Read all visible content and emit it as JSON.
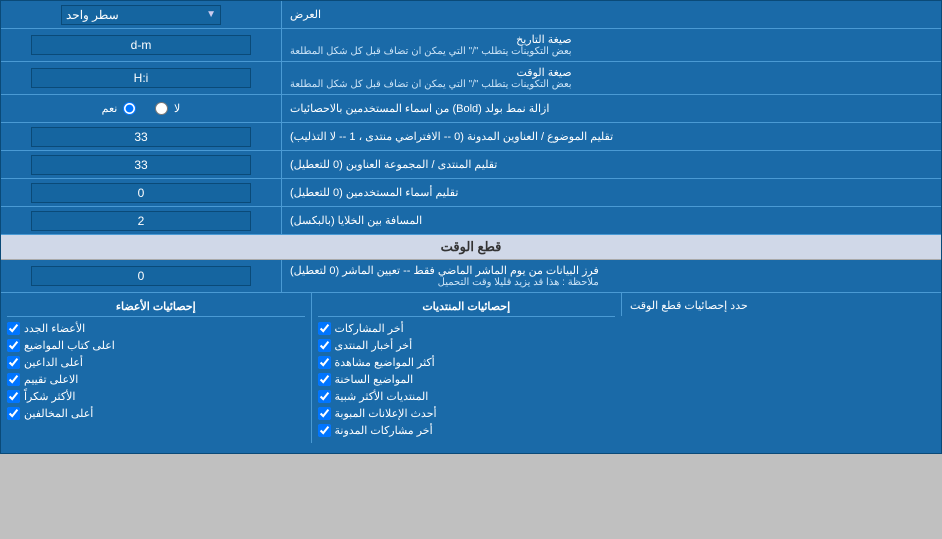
{
  "title": "العرض",
  "rows": [
    {
      "id": "row-display",
      "label": "العرض",
      "input_type": "dropdown",
      "input_value": "سطر واحد"
    },
    {
      "id": "row-date-format",
      "label": "صيغة التاريخ",
      "label_sub": "بعض التكوينات يتطلب \"/\" التي يمكن ان تضاف قبل كل شكل المطلعة",
      "input_type": "text",
      "input_value": "d-m"
    },
    {
      "id": "row-time-format",
      "label": "صيغة الوقت",
      "label_sub": "بعض التكوينات يتطلب \"/\" التي يمكن ان تضاف قبل كل شكل المطلعة",
      "input_type": "text",
      "input_value": "H:i"
    },
    {
      "id": "row-bold",
      "label": "ازالة نمط بولد (Bold) من اسماء المستخدمين بالاحصائيات",
      "input_type": "radio",
      "radio_yes": "نعم",
      "radio_no": "لا",
      "selected": "no"
    },
    {
      "id": "row-topic-trim",
      "label": "تقليم الموضوع / العناوين المدونة (0 -- الافتراضي منتدى ، 1 -- لا التذليب)",
      "input_type": "text",
      "input_value": "33"
    },
    {
      "id": "row-forum-trim",
      "label": "تقليم المنتدى / المجموعة العناوين (0 للتعطيل)",
      "input_type": "text",
      "input_value": "33"
    },
    {
      "id": "row-user-trim",
      "label": "تقليم أسماء المستخدمين (0 للتعطيل)",
      "input_type": "text",
      "input_value": "0"
    },
    {
      "id": "row-space",
      "label": "المسافة بين الخلايا (بالبكسل)",
      "input_type": "text",
      "input_value": "2"
    }
  ],
  "section_cutoff": {
    "title": "قطع الوقت",
    "row": {
      "label": "فرز البيانات من يوم الماشر الماضي فقط -- تعيين الماشر (0 لتعطيل)",
      "label_note": "ملاحظة : هذا قد يزيد قليلا وقت التحميل",
      "input_value": "0"
    },
    "stats_label": "حدد إحصائيات قطع الوقت"
  },
  "stats": {
    "col1_header": "إحصائيات المنتديات",
    "col1_items": [
      "أخر المشاركات",
      "أخر أخبار المنتدى",
      "أكثر المواضيع مشاهدة",
      "المواضيع الساخنة",
      "المنتديات الأكثر شبية",
      "أحدث الإعلانات المبوبة",
      "أخر مشاركات المدونة"
    ],
    "col2_header": "إحصائيات الأعضاء",
    "col2_items": [
      "الأعضاء الجدد",
      "اعلى كتاب المواضيع",
      "أعلى الداعين",
      "الاعلى تقييم",
      "الأكثر شكراً",
      "أعلى المخالفين"
    ]
  },
  "labels": {
    "display_label": "العرض",
    "one_line": "سطر واحد",
    "date_format_label": "صيغة التاريخ",
    "date_sub": "بعض التكوينات يتطلب \"/\" التي يمكن ان تضاف قبل كل شكل المطلعة",
    "time_format_label": "صيغة الوقت",
    "time_sub": "بعض التكوينات يتطلب \"/\" التي يمكن ان تضاف قبل كل شكل المطلعة",
    "bold_label": "ازالة نمط بولد (Bold) من اسماء المستخدمين بالاحصائيات",
    "yes": "نعم",
    "no": "لا",
    "topic_trim": "تقليم الموضوع / العناوين المدونة (0 -- الافتراضي منتدى ، 1 -- لا التذليب)",
    "forum_trim": "تقليم المنتدى / المجموعة العناوين (0 للتعطيل)",
    "user_trim": "تقليم أسماء المستخدمين (0 للتعطيل)",
    "space_label": "المسافة بين الخلايا (بالبكسل)",
    "cutoff_title": "قطع الوقت",
    "cutoff_label": "فرز البيانات من يوم الماشر الماضي فقط -- تعيين الماشر (0 لتعطيل)",
    "cutoff_note": "ملاحظة : هذا قد يزيد قليلا وقت التحميل",
    "stats_cutoff": "حدد إحصائيات قطع الوقت",
    "stats_forums": "إحصائيات المنتديات",
    "stats_members": "إحصائيات الأعضاء",
    "item_last_posts": "أخر المشاركات",
    "item_last_news": "أخر أخبار المنتدى",
    "item_most_viewed": "أكثر المواضيع مشاهدة",
    "item_hot_topics": "المواضيع الساخنة",
    "item_similar": "المنتديات الأكثر شبية",
    "item_latest_ads": "أحدث الإعلانات المبوبة",
    "item_last_blog": "أخر مشاركات المدونة",
    "item_new_members": "الأعضاء الجدد",
    "item_top_writers": "اعلى كتاب المواضيع",
    "item_top_inviters": "أعلى الداعين",
    "item_top_rated": "الاعلى تقييم",
    "item_most_thanks": "الأكثر شكراً",
    "item_violations": "أعلى المخالفين"
  }
}
